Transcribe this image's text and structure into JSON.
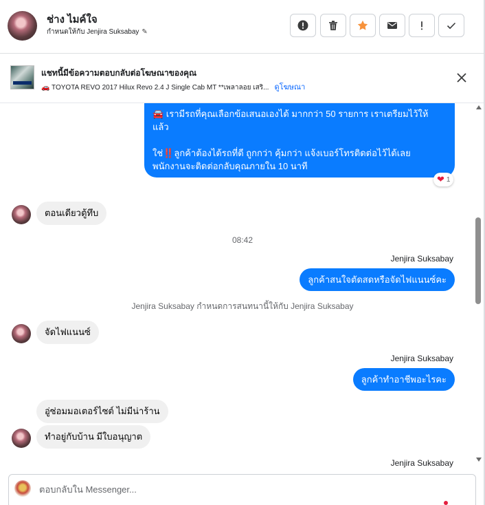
{
  "header": {
    "name": "ช่าง ไมค์ใจ",
    "assigned_text": "กำหนดให้กับ Jenjira Suksabay",
    "actions": [
      {
        "name": "report-button",
        "icon": "info-circle-icon"
      },
      {
        "name": "delete-button",
        "icon": "trash-icon"
      },
      {
        "name": "star-button",
        "icon": "star-icon"
      },
      {
        "name": "mark-unread-button",
        "icon": "envelope-icon"
      },
      {
        "name": "follow-up-button",
        "icon": "exclamation-icon"
      },
      {
        "name": "mark-done-button",
        "icon": "checkmark-icon"
      }
    ],
    "star_color": "#f7923b"
  },
  "ad_banner": {
    "title": "แชทนี้มีข้อความตอบกลับต่อโฆษณาของคุณ",
    "subtitle": "🚗 TOYOTA REVO 2017 Hilux Revo 2.4 J Single Cab MT **เพลาลอย เสริ...",
    "link": "ดูโฆษณา"
  },
  "messages": {
    "out_long_line1": "🚘 เรามีรถที่คุณเลือกข้อเสนอเองได้ มากกว่า 50 รายการ เราเตรียมไว้ให้",
    "out_long_line2": "แล้ว",
    "out_long_line3_a": "ใช่",
    "out_long_line3_b": "‼️",
    "out_long_line3_c": "ลูกค้าต้องได้รถที่ดี ถูกกว่า คุ้มกว่า แจ้งเบอร์โทรติดต่อไว้ได้เลย",
    "out_long_line4": "พนักงานจะติดต่อกลับคุณภายใน 10 นาที",
    "reaction_count": "1",
    "in_1": "ตอนเดียวตู้ทึบ",
    "timestamp": "08:42",
    "sender_1": "Jenjira Suksabay",
    "out_2": "ลูกค้าสนใจตัดสดหรือจัดไฟแนนซ์คะ",
    "system_note": "Jenjira Suksabay กำหนดการสนทนานี้ให้กับ Jenjira Suksabay",
    "in_2": "จัดไฟแนนซ์",
    "sender_2": "Jenjira Suksabay",
    "out_3": "ลูกค้าทำอาชีพอะไรคะ",
    "in_3": "อู่ซ่อมมอเตอร์ไซต์  ไม่มีน่าร้าน",
    "in_4": "ทำอยู่กับบ้าน  มีใบอนุญาต",
    "sender_3": "Jenjira Suksabay"
  },
  "composer": {
    "placeholder": "ตอบกลับใน Messenger..."
  }
}
